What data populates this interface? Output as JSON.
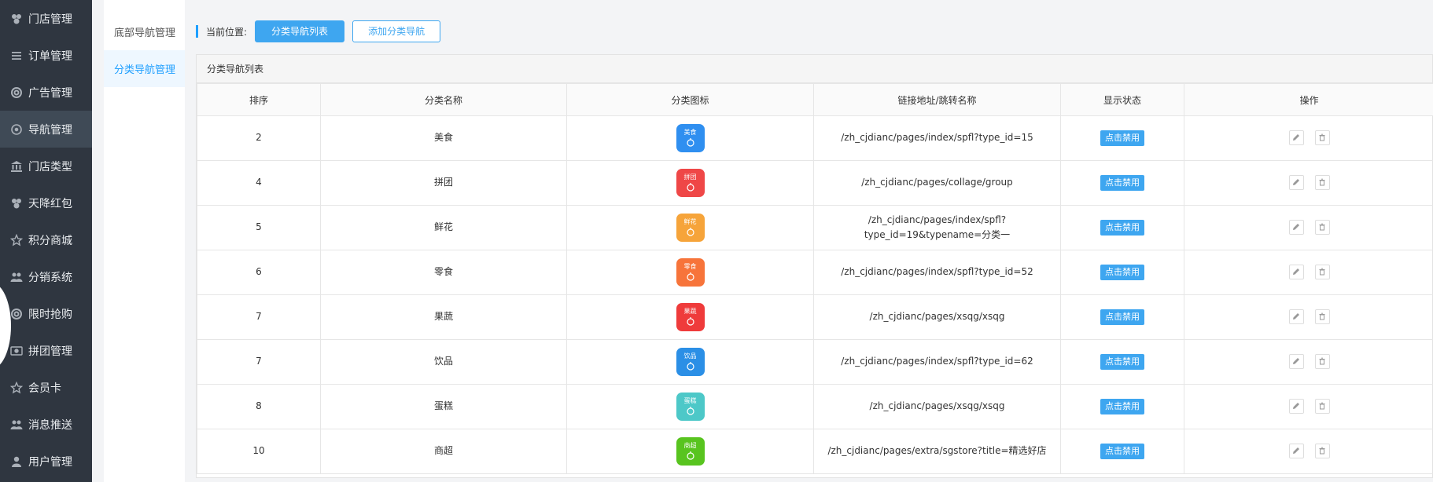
{
  "sidebar": {
    "items": [
      {
        "label": "门店管理",
        "icon": "store-icon",
        "active": false
      },
      {
        "label": "订单管理",
        "icon": "list-icon",
        "active": false
      },
      {
        "label": "广告管理",
        "icon": "ad-icon",
        "active": false
      },
      {
        "label": "导航管理",
        "icon": "compass-icon",
        "active": true
      },
      {
        "label": "门店类型",
        "icon": "bank-icon",
        "active": false
      },
      {
        "label": "天降红包",
        "icon": "redpacket-icon",
        "active": false
      },
      {
        "label": "积分商城",
        "icon": "star-icon",
        "active": false
      },
      {
        "label": "分销系统",
        "icon": "users-icon",
        "active": false
      },
      {
        "label": "限时抢购",
        "icon": "clock-icon",
        "active": false
      },
      {
        "label": "拼团管理",
        "icon": "group-icon",
        "active": false
      },
      {
        "label": "会员卡",
        "icon": "star-icon",
        "active": false
      },
      {
        "label": "消息推送",
        "icon": "users-icon",
        "active": false
      },
      {
        "label": "用户管理",
        "icon": "user-icon",
        "active": false
      }
    ]
  },
  "submenu": {
    "items": [
      {
        "label": "底部导航管理",
        "active": false
      },
      {
        "label": "分类导航管理",
        "active": true
      }
    ]
  },
  "topbar": {
    "location_label": "当前位置:",
    "list_button": "分类导航列表",
    "add_button": "添加分类导航"
  },
  "panel": {
    "title": "分类导航列表",
    "columns": [
      "排序",
      "分类名称",
      "分类图标",
      "链接地址/跳转名称",
      "显示状态",
      "操作"
    ],
    "status_label": "点击禁用",
    "rows": [
      {
        "sort": "2",
        "name": "美食",
        "icon_text": "美食",
        "icon_color": "#2f8ff0",
        "link": "/zh_cjdianc/pages/index/spfl?type_id=15"
      },
      {
        "sort": "4",
        "name": "拼团",
        "icon_text": "拼团",
        "icon_color": "#ef4747",
        "link": "/zh_cjdianc/pages/collage/group"
      },
      {
        "sort": "5",
        "name": "鲜花",
        "icon_text": "鲜花",
        "icon_color": "#f6a43a",
        "link": "/zh_cjdianc/pages/index/spfl?type_id=19&typename=分类一"
      },
      {
        "sort": "6",
        "name": "零食",
        "icon_text": "零食",
        "icon_color": "#f7743a",
        "link": "/zh_cjdianc/pages/index/spfl?type_id=52"
      },
      {
        "sort": "7",
        "name": "果蔬",
        "icon_text": "果蔬",
        "icon_color": "#ef3b3b",
        "link": "/zh_cjdianc/pages/xsqg/xsqg"
      },
      {
        "sort": "7",
        "name": "饮品",
        "icon_text": "饮品",
        "icon_color": "#2b8fe6",
        "link": "/zh_cjdianc/pages/index/spfl?type_id=62"
      },
      {
        "sort": "8",
        "name": "蛋糕",
        "icon_text": "蛋糕",
        "icon_color": "#4dc8c8",
        "link": "/zh_cjdianc/pages/xsqg/xsqg"
      },
      {
        "sort": "10",
        "name": "商超",
        "icon_text": "商超",
        "icon_color": "#58c41f",
        "link": "/zh_cjdianc/pages/extra/sgstore?title=精选好店"
      }
    ]
  }
}
